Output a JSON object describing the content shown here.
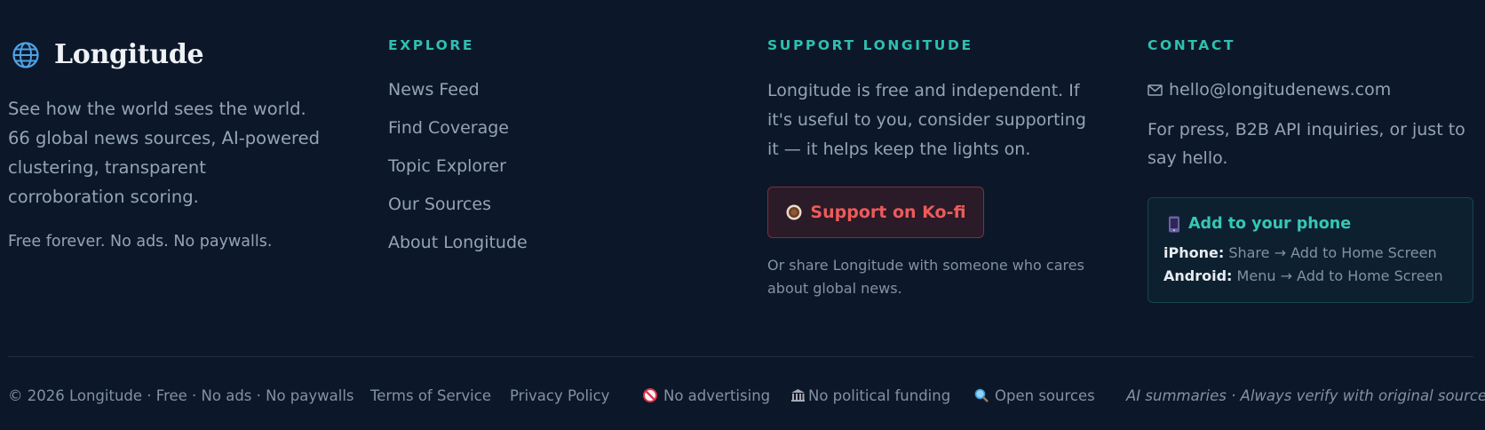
{
  "brand": {
    "name": "Longitude",
    "description": "See how the world sees the world. 66 global news sources, AI-powered clustering, transparent corroboration scoring.",
    "tagline": "Free forever. No ads. No paywalls."
  },
  "explore": {
    "heading": "EXPLORE",
    "links": [
      "News Feed",
      "Find Coverage",
      "Topic Explorer",
      "Our Sources",
      "About Longitude"
    ]
  },
  "support": {
    "heading": "SUPPORT LONGITUDE",
    "text": "Longitude is free and independent. If it's useful to you, consider supporting it — it helps keep the lights on.",
    "button_label": "Support on Ko-fi",
    "share_text": "Or share Longitude with someone who cares about global news."
  },
  "contact": {
    "heading": "CONTACT",
    "email": "hello@longitudenews.com",
    "press_text": "For press, B2B API inquiries, or just to say hello.",
    "phone_card": {
      "title": "Add to your phone",
      "iphone_label": "iPhone:",
      "iphone_text": "Share → Add to Home Screen",
      "android_label": "Android:",
      "android_text": "Menu → Add to Home Screen"
    }
  },
  "footer": {
    "copyright": "© 2026 Longitude · Free · No ads · No paywalls",
    "terms": "Terms of Service",
    "privacy": "Privacy Policy",
    "no_advertising": "No advertising",
    "no_political_funding": "No political funding",
    "open_sources": "Open sources",
    "disclaimer": "AI summaries · Always verify with original sources"
  },
  "colors": {
    "background": "#0c1829",
    "accent_teal": "#2fbfb0",
    "kofi_red": "#ec5b5b",
    "text_muted": "#94a3b8"
  },
  "icons": {
    "brand": "globe-icon",
    "kofi": "coffee-cup-icon",
    "email": "mail-icon",
    "phone": "mobile-phone-icon",
    "no_advertising": "prohibited-icon",
    "no_political_funding": "classical-building-icon",
    "open_sources": "magnifying-glass-icon"
  }
}
